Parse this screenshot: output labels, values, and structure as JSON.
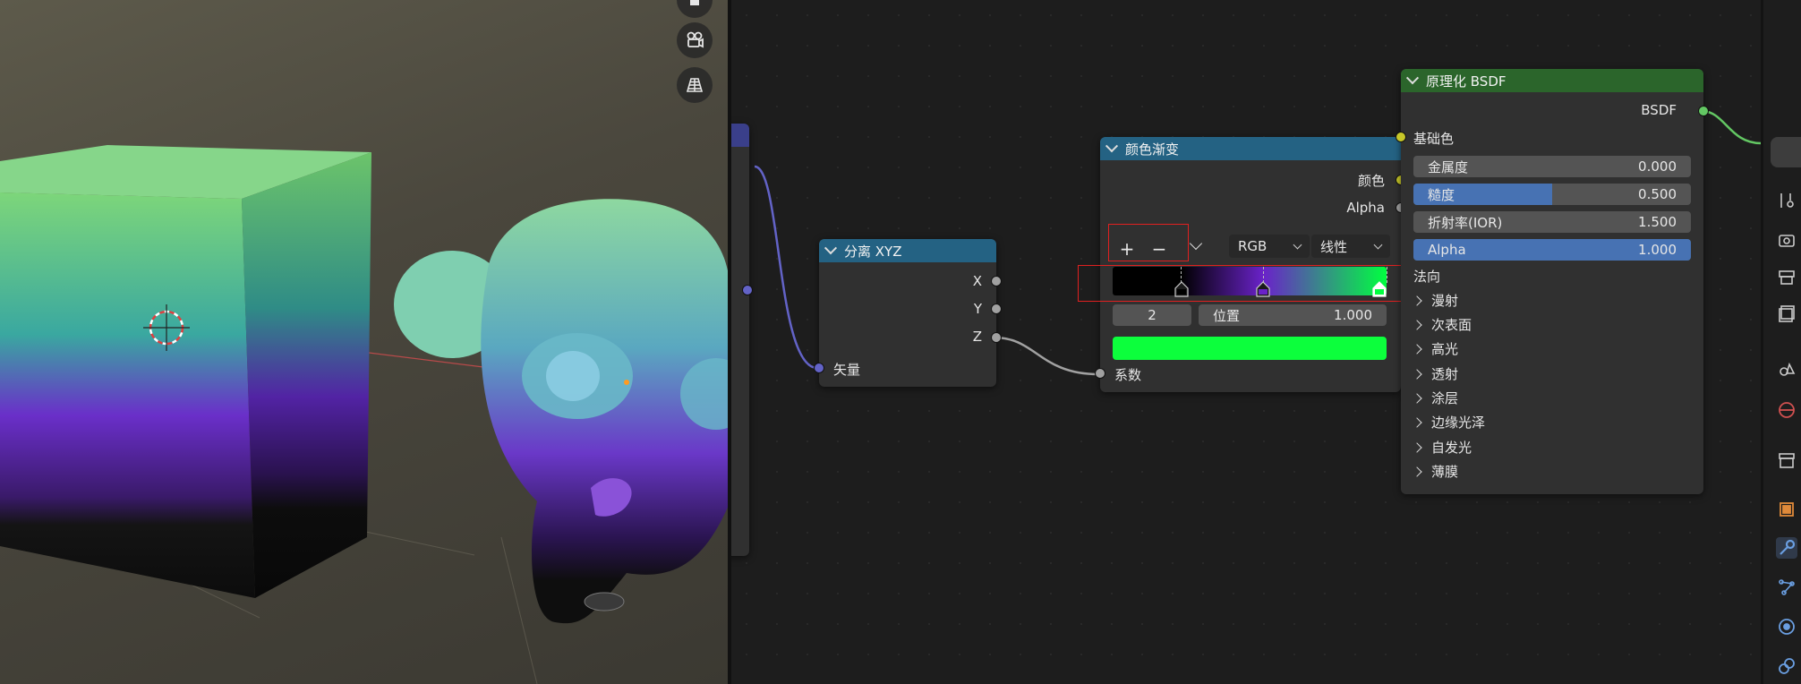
{
  "colors": {
    "accent_blue": "#4772b3",
    "header_blue": "#246283",
    "header_green": "#2b652b",
    "socket_gray": "#a1a1a1",
    "socket_yellow": "#c7c729",
    "socket_purple": "#6363c7",
    "socket_green": "#63c763",
    "highlight_red": "#e02020"
  },
  "viewport": {
    "gizmos": [
      "hand-icon",
      "camera-icon",
      "grid-icon"
    ],
    "cut_label": "量"
  },
  "separate_xyz": {
    "title": "分离 XYZ",
    "outputs": [
      "X",
      "Y",
      "Z"
    ],
    "input": "矢量"
  },
  "color_ramp": {
    "title": "颜色渐变",
    "outputs": [
      "颜色",
      "Alpha"
    ],
    "add_label": "+",
    "remove_label": "−",
    "color_mode": "RGB",
    "interpolation": "线性",
    "stops": [
      {
        "position": 0.25,
        "color": "#000000"
      },
      {
        "position": 0.55,
        "color": "#6a22c9"
      },
      {
        "position": 1.0,
        "color": "#00ff40"
      }
    ],
    "active_index": "2",
    "position_label": "位置",
    "position_value": "1.000",
    "active_color": "#0cff3c",
    "input": "系数"
  },
  "principled": {
    "title": "原理化 BSDF",
    "output": "BSDF",
    "base_color_label": "基础色",
    "fields": [
      {
        "label": "金属度",
        "value": "0.000",
        "fill": 0.0
      },
      {
        "label": "糙度",
        "value": "0.500",
        "fill": 0.5
      },
      {
        "label": "折射率(IOR)",
        "value": "1.500",
        "fill": 0.0
      },
      {
        "label": "Alpha",
        "value": "1.000",
        "fill": 1.0
      }
    ],
    "normal_label": "法向",
    "panels": [
      "漫射",
      "次表面",
      "高光",
      "透射",
      "涂层",
      "边缘光泽",
      "自发光",
      "薄膜"
    ]
  },
  "right_tabs": [
    "tool-icon",
    "render-icon",
    "output-icon",
    "view-layer-icon",
    "scene-icon",
    "world-icon",
    "collection-icon",
    "object-icon",
    "modifier-icon",
    "particles-icon",
    "physics-icon",
    "constraints-icon"
  ]
}
